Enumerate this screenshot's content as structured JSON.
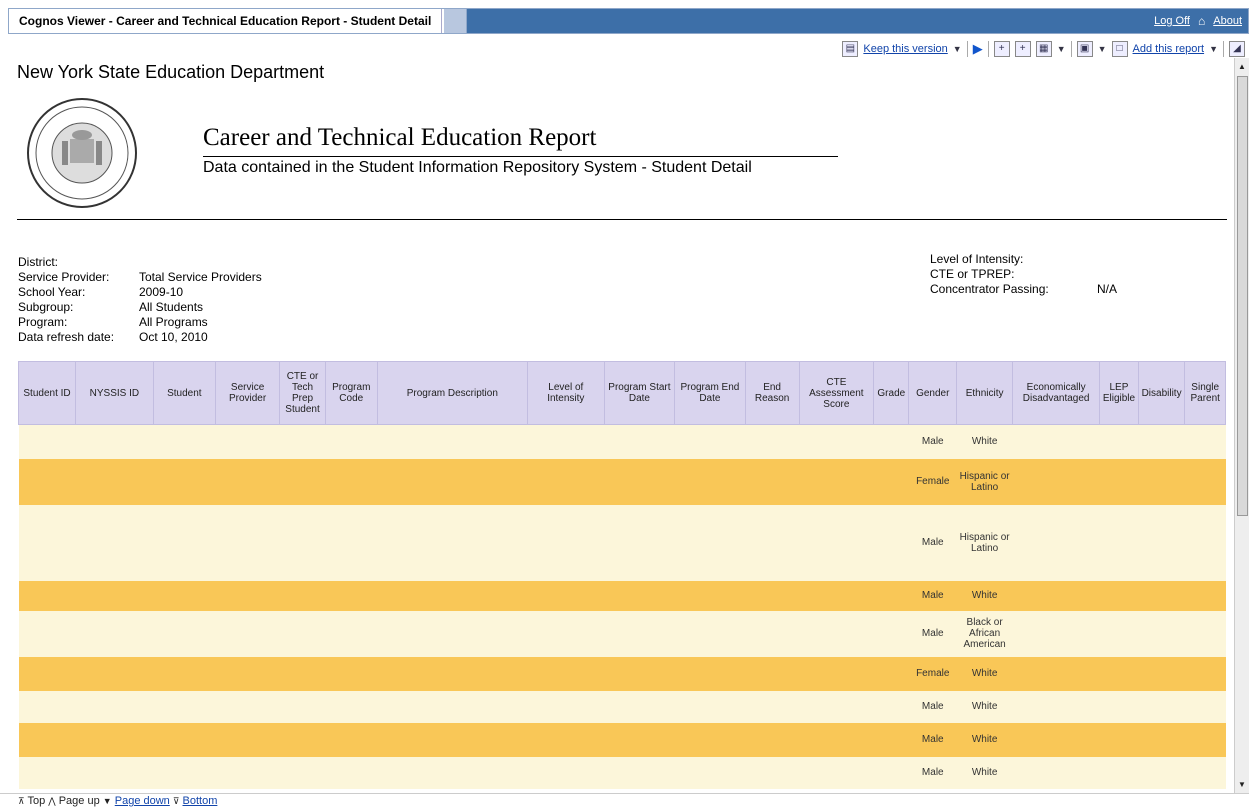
{
  "window": {
    "title": "Cognos Viewer - Career and Technical Education Report - Student Detail",
    "logoff": "Log Off",
    "about": "About"
  },
  "toolbar": {
    "keep_version": "Keep this version",
    "add_report": "Add this report"
  },
  "header": {
    "org": "New York State Education Department",
    "title": "Career and Technical Education Report",
    "subtitle": "Data contained in the Student Information Repository System - Student Detail"
  },
  "params_left": [
    {
      "label": "District:",
      "value": ""
    },
    {
      "label": "Service Provider:",
      "value": "Total Service Providers"
    },
    {
      "label": "School Year:",
      "value": "2009-10"
    },
    {
      "label": "Subgroup:",
      "value": "All Students"
    },
    {
      "label": "Program:",
      "value": "All Programs"
    },
    {
      "label": "Data refresh date:",
      "value": "Oct 10, 2010"
    }
  ],
  "params_right": [
    {
      "label": "Level of Intensity:",
      "value": ""
    },
    {
      "label": "CTE or TPREP:",
      "value": ""
    },
    {
      "label": "Concentrator Passing:",
      "value": "N/A"
    }
  ],
  "table": {
    "columns": [
      "Student ID",
      "NYSSIS ID",
      "Student",
      "Service Provider",
      "CTE or Tech Prep Student",
      "Program Code",
      "Program Description",
      "Level of Intensity",
      "Program Start Date",
      "Program End Date",
      "End Reason",
      "CTE Assessment Score",
      "Grade",
      "Gender",
      "Ethnicity",
      "Economically Disadvantaged",
      "LEP Eligible",
      "Disability",
      "Single Parent"
    ],
    "rows": [
      {
        "gender": "Male",
        "ethnicity": "White"
      },
      {
        "gender": "Female",
        "ethnicity": "Hispanic or Latino"
      },
      {
        "gender": "Male",
        "ethnicity": "Hispanic or Latino"
      },
      {
        "gender": "Male",
        "ethnicity": "White"
      },
      {
        "gender": "Male",
        "ethnicity": "Black or African American"
      },
      {
        "gender": "Female",
        "ethnicity": "White"
      },
      {
        "gender": "Male",
        "ethnicity": "White"
      },
      {
        "gender": "Male",
        "ethnicity": "White"
      },
      {
        "gender": "Male",
        "ethnicity": "White"
      }
    ]
  },
  "footer": {
    "top": "Top",
    "page_up": "Page up",
    "page_down": "Page down",
    "bottom": "Bottom"
  },
  "colors": {
    "header_bar": "#3d6fa8",
    "table_header": "#d9d4ee",
    "row_light": "#fcf6da",
    "row_dark": "#f9c757"
  }
}
